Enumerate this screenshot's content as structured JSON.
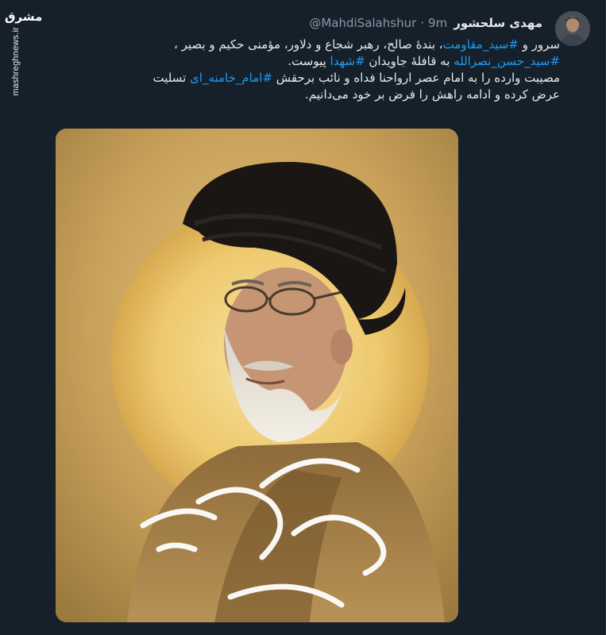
{
  "tweet": {
    "display_name": "مهدی سلحشور",
    "handle": "@MahdiSalahshur",
    "separator": "·",
    "time": "9m",
    "text": {
      "line1": {
        "t1": "سرور و ",
        "h1": "#سید_مقاومت",
        "t2": "، بندهٔ صالح، رهبر شجاع و دلاور، مؤمنی حکیم و بصیر ،"
      },
      "line2": {
        "h1": "#سید_حسن_نصرالله",
        "t1": " به قافلهٔ جاویدان ",
        "h2": "#شهدا",
        "t2": " پیوست."
      },
      "line3": {
        "t1": "مصیبت وارده را به امام عصر ارواحنا فداه و نائب برحقش ",
        "h1": "#امام_خامنه_ای",
        "t2": " تسلیت"
      },
      "line4": "عرض کرده و ادامه راهش را فرض بر خود می‌دانیم."
    },
    "media": {
      "calligraphy_name": "سید حسن نصرالله",
      "calligraphy_subtitle": "شهید جاودان مقاومت"
    }
  },
  "watermark": {
    "logo": "مشرق",
    "site": "mashreghnews.ir"
  },
  "colors": {
    "background": "#15202b",
    "hashtag": "#1d9bf0",
    "text": "#e7e9ea",
    "secondary": "#8b98a5",
    "poster_gold": "#c7a05a"
  },
  "icons": {
    "avatar": "profile-photo",
    "watermark": "mashregh-logo"
  }
}
